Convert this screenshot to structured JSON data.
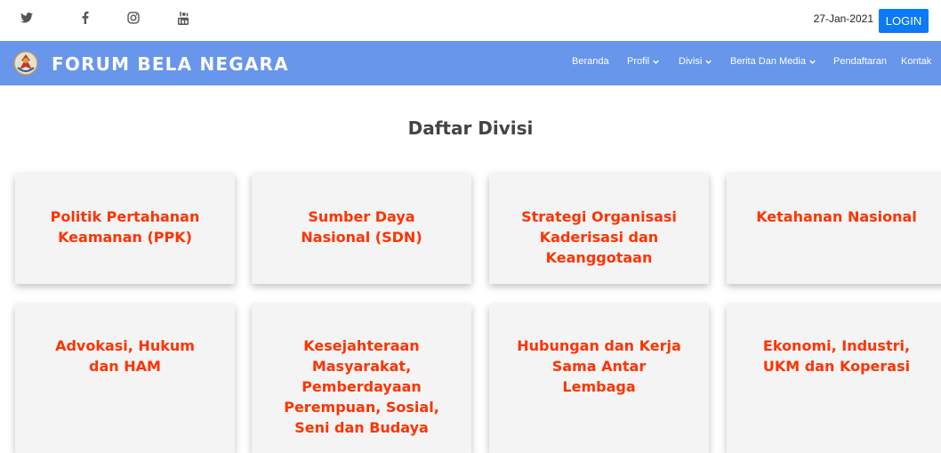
{
  "topbar": {
    "social": [
      {
        "name": "twitter-icon"
      },
      {
        "name": "facebook-icon"
      },
      {
        "name": "instagram-icon"
      },
      {
        "name": "youtube-icon"
      }
    ],
    "date": "27-Jan-2021",
    "login_label": "LOGIN",
    "login_color": "#0a7af5"
  },
  "navbar": {
    "brand": "FORUM BELA NEGARA",
    "bg_color": "#6796ea",
    "items": [
      {
        "label": "Beranda",
        "dropdown": false
      },
      {
        "label": "Profil",
        "dropdown": true
      },
      {
        "label": "Divisi",
        "dropdown": true
      },
      {
        "label": "Berita Dan Media",
        "dropdown": true
      },
      {
        "label": "Pendaftaran",
        "dropdown": false
      },
      {
        "label": "Kontak",
        "dropdown": false
      }
    ]
  },
  "main": {
    "title": "Daftar Divisi",
    "title_color": "#444444",
    "card_text_color": "#ff3300",
    "divisions": [
      {
        "label": "Politik Pertahanan Keamanan (PPK)"
      },
      {
        "label": "Sumber Daya Nasional (SDN)"
      },
      {
        "label": "Strategi Organisasi Kaderisasi dan Keanggotaan"
      },
      {
        "label": "Ketahanan Nasional"
      },
      {
        "label": "Advokasi, Hukum dan HAM"
      },
      {
        "label": "Kesejahteraan Masyarakat, Pemberdayaan Perempuan, Sosial, Seni dan Budaya"
      },
      {
        "label": "Hubungan dan Kerja Sama Antar Lembaga"
      },
      {
        "label": "Ekonomi, Industri, UKM dan Koperasi"
      }
    ]
  }
}
